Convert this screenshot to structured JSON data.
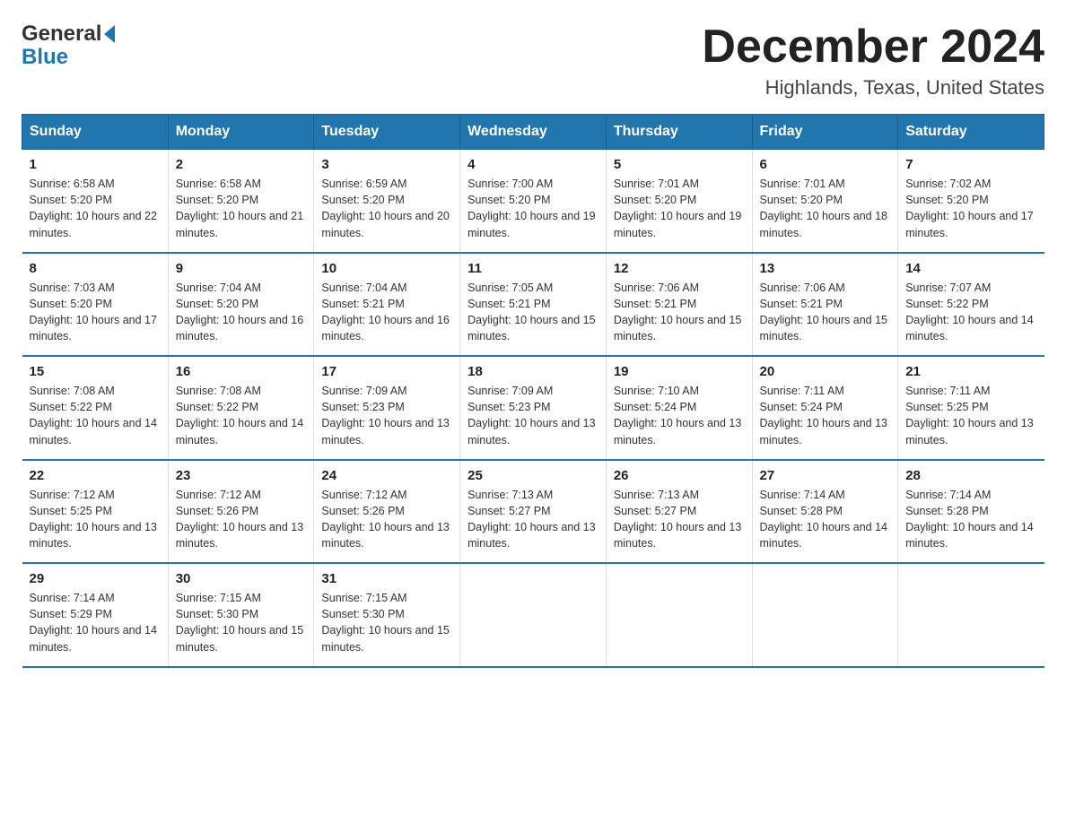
{
  "header": {
    "logo_general": "General",
    "logo_blue": "Blue",
    "title": "December 2024",
    "subtitle": "Highlands, Texas, United States"
  },
  "days_of_week": [
    "Sunday",
    "Monday",
    "Tuesday",
    "Wednesday",
    "Thursday",
    "Friday",
    "Saturday"
  ],
  "weeks": [
    [
      {
        "day": "1",
        "sunrise": "6:58 AM",
        "sunset": "5:20 PM",
        "daylight": "10 hours and 22 minutes."
      },
      {
        "day": "2",
        "sunrise": "6:58 AM",
        "sunset": "5:20 PM",
        "daylight": "10 hours and 21 minutes."
      },
      {
        "day": "3",
        "sunrise": "6:59 AM",
        "sunset": "5:20 PM",
        "daylight": "10 hours and 20 minutes."
      },
      {
        "day": "4",
        "sunrise": "7:00 AM",
        "sunset": "5:20 PM",
        "daylight": "10 hours and 19 minutes."
      },
      {
        "day": "5",
        "sunrise": "7:01 AM",
        "sunset": "5:20 PM",
        "daylight": "10 hours and 19 minutes."
      },
      {
        "day": "6",
        "sunrise": "7:01 AM",
        "sunset": "5:20 PM",
        "daylight": "10 hours and 18 minutes."
      },
      {
        "day": "7",
        "sunrise": "7:02 AM",
        "sunset": "5:20 PM",
        "daylight": "10 hours and 17 minutes."
      }
    ],
    [
      {
        "day": "8",
        "sunrise": "7:03 AM",
        "sunset": "5:20 PM",
        "daylight": "10 hours and 17 minutes."
      },
      {
        "day": "9",
        "sunrise": "7:04 AM",
        "sunset": "5:20 PM",
        "daylight": "10 hours and 16 minutes."
      },
      {
        "day": "10",
        "sunrise": "7:04 AM",
        "sunset": "5:21 PM",
        "daylight": "10 hours and 16 minutes."
      },
      {
        "day": "11",
        "sunrise": "7:05 AM",
        "sunset": "5:21 PM",
        "daylight": "10 hours and 15 minutes."
      },
      {
        "day": "12",
        "sunrise": "7:06 AM",
        "sunset": "5:21 PM",
        "daylight": "10 hours and 15 minutes."
      },
      {
        "day": "13",
        "sunrise": "7:06 AM",
        "sunset": "5:21 PM",
        "daylight": "10 hours and 15 minutes."
      },
      {
        "day": "14",
        "sunrise": "7:07 AM",
        "sunset": "5:22 PM",
        "daylight": "10 hours and 14 minutes."
      }
    ],
    [
      {
        "day": "15",
        "sunrise": "7:08 AM",
        "sunset": "5:22 PM",
        "daylight": "10 hours and 14 minutes."
      },
      {
        "day": "16",
        "sunrise": "7:08 AM",
        "sunset": "5:22 PM",
        "daylight": "10 hours and 14 minutes."
      },
      {
        "day": "17",
        "sunrise": "7:09 AM",
        "sunset": "5:23 PM",
        "daylight": "10 hours and 13 minutes."
      },
      {
        "day": "18",
        "sunrise": "7:09 AM",
        "sunset": "5:23 PM",
        "daylight": "10 hours and 13 minutes."
      },
      {
        "day": "19",
        "sunrise": "7:10 AM",
        "sunset": "5:24 PM",
        "daylight": "10 hours and 13 minutes."
      },
      {
        "day": "20",
        "sunrise": "7:11 AM",
        "sunset": "5:24 PM",
        "daylight": "10 hours and 13 minutes."
      },
      {
        "day": "21",
        "sunrise": "7:11 AM",
        "sunset": "5:25 PM",
        "daylight": "10 hours and 13 minutes."
      }
    ],
    [
      {
        "day": "22",
        "sunrise": "7:12 AM",
        "sunset": "5:25 PM",
        "daylight": "10 hours and 13 minutes."
      },
      {
        "day": "23",
        "sunrise": "7:12 AM",
        "sunset": "5:26 PM",
        "daylight": "10 hours and 13 minutes."
      },
      {
        "day": "24",
        "sunrise": "7:12 AM",
        "sunset": "5:26 PM",
        "daylight": "10 hours and 13 minutes."
      },
      {
        "day": "25",
        "sunrise": "7:13 AM",
        "sunset": "5:27 PM",
        "daylight": "10 hours and 13 minutes."
      },
      {
        "day": "26",
        "sunrise": "7:13 AM",
        "sunset": "5:27 PM",
        "daylight": "10 hours and 13 minutes."
      },
      {
        "day": "27",
        "sunrise": "7:14 AM",
        "sunset": "5:28 PM",
        "daylight": "10 hours and 14 minutes."
      },
      {
        "day": "28",
        "sunrise": "7:14 AM",
        "sunset": "5:28 PM",
        "daylight": "10 hours and 14 minutes."
      }
    ],
    [
      {
        "day": "29",
        "sunrise": "7:14 AM",
        "sunset": "5:29 PM",
        "daylight": "10 hours and 14 minutes."
      },
      {
        "day": "30",
        "sunrise": "7:15 AM",
        "sunset": "5:30 PM",
        "daylight": "10 hours and 15 minutes."
      },
      {
        "day": "31",
        "sunrise": "7:15 AM",
        "sunset": "5:30 PM",
        "daylight": "10 hours and 15 minutes."
      },
      {
        "day": "",
        "sunrise": "",
        "sunset": "",
        "daylight": ""
      },
      {
        "day": "",
        "sunrise": "",
        "sunset": "",
        "daylight": ""
      },
      {
        "day": "",
        "sunrise": "",
        "sunset": "",
        "daylight": ""
      },
      {
        "day": "",
        "sunrise": "",
        "sunset": "",
        "daylight": ""
      }
    ]
  ],
  "labels": {
    "sunrise_prefix": "Sunrise: ",
    "sunset_prefix": "Sunset: ",
    "daylight_prefix": "Daylight: "
  }
}
